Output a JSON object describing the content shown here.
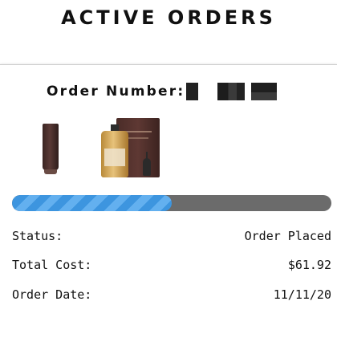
{
  "header": {
    "title": "ACTIVE ORDERS"
  },
  "order": {
    "number_label": "Order Number:",
    "products": [
      {
        "name": "product-tube"
      },
      {
        "name": "product-serum-kit"
      }
    ],
    "progress_percent": 50,
    "status_label": "Status:",
    "status_value": "Order Placed",
    "total_label": "Total Cost:",
    "total_value": "$61.92",
    "date_label": "Order Date:",
    "date_value": "11/11/20"
  },
  "colors": {
    "progress_fill": "#3d95df",
    "progress_track": "#6b6b6b"
  }
}
